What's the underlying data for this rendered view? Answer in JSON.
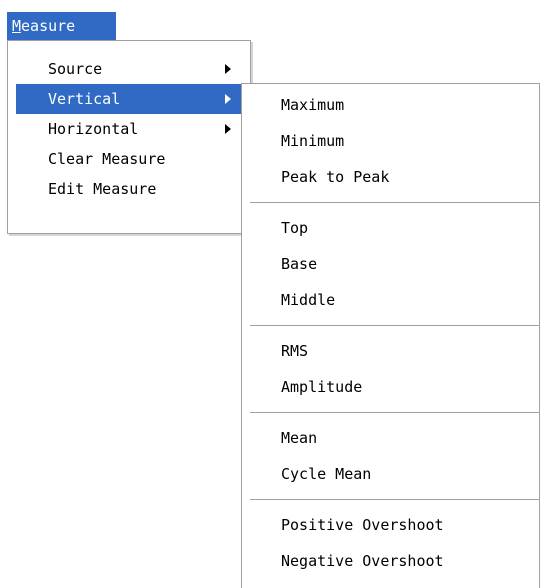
{
  "menubar": {
    "title_accel": "M",
    "title_rest": "easure"
  },
  "main_menu": {
    "items": [
      {
        "label": "Source",
        "has_submenu": true
      },
      {
        "label": "Vertical",
        "has_submenu": true,
        "selected": true
      },
      {
        "label": "Horizontal",
        "has_submenu": true
      },
      {
        "label": "Clear Measure"
      },
      {
        "label": "Edit Measure"
      }
    ]
  },
  "vertical_submenu": {
    "groups": [
      [
        "Maximum",
        "Minimum",
        "Peak to Peak"
      ],
      [
        "Top",
        "Base",
        "Middle"
      ],
      [
        "RMS",
        "Amplitude"
      ],
      [
        "Mean",
        "Cycle Mean"
      ],
      [
        "Positive Overshoot",
        "Negative Overshoot"
      ]
    ]
  },
  "colors": {
    "highlight": "#316ac5",
    "highlight_text": "#ffffff",
    "menu_background": "#ffffff",
    "border": "#a0a0a0"
  }
}
